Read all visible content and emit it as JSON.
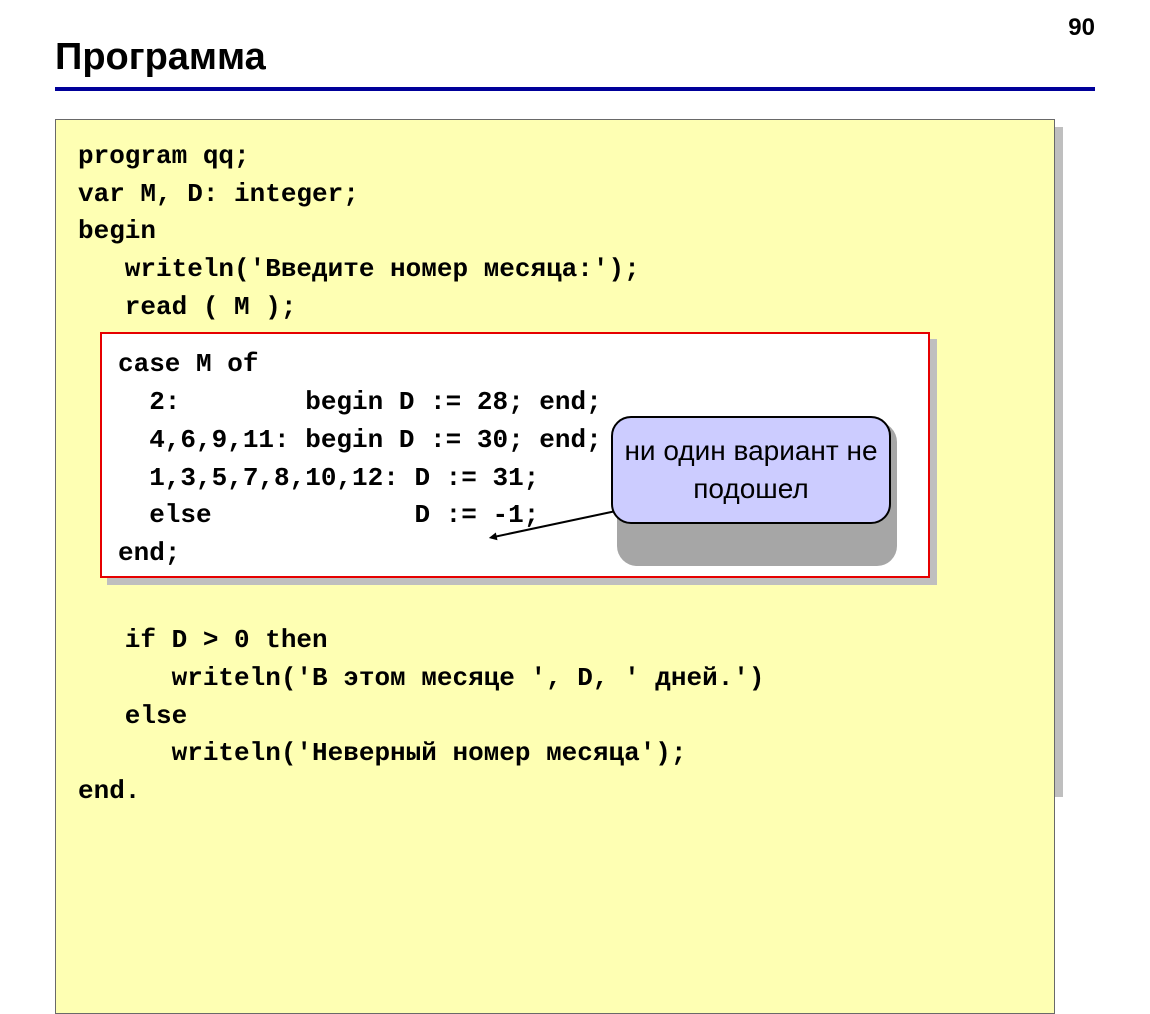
{
  "page_number": "90",
  "title": "Программа",
  "code": {
    "pre1": "program qq;\nvar M, D: integer;\nbegin\n   writeln('Введите номер месяца:');\n   read ( M );",
    "case_block": "case M of\n  2:        begin D := 28; end;\n  4,6,9,11: begin D := 30; end;\n  1,3,5,7,8,10,12: D := 31;\n  else             D := -1;\nend;",
    "pre2": "   if D > 0 then\n      writeln('В этом месяце ', D, ' дней.')\n   else\n      writeln('Неверный номер месяца');\nend."
  },
  "callout": "ни один вариант не подошел"
}
